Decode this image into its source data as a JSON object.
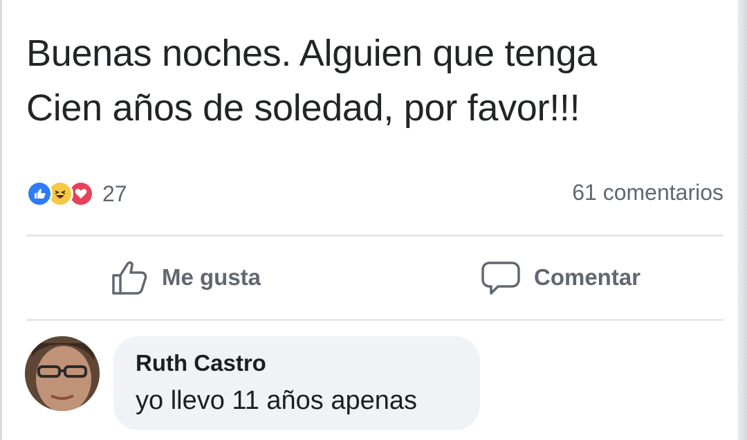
{
  "post": {
    "text_line1": "Buenas noches. Alguien que tenga",
    "text_line2": "Cien años de soledad, por favor!!!"
  },
  "reactions": {
    "types": [
      "like-icon",
      "haha-icon",
      "love-icon"
    ],
    "count": "27",
    "colors": {
      "like": "#2e7cf6",
      "haha": "#f7c843",
      "love": "#e8415a"
    }
  },
  "comments_summary": "61 comentarios",
  "actions": {
    "like_label": "Me gusta",
    "comment_label": "Comentar"
  },
  "comment": {
    "author": "Ruth Castro",
    "text": "yo llevo 11 años apenas"
  },
  "colors": {
    "text": "#1c1e21",
    "secondary_text": "#606770",
    "bubble": "#f0f2f5",
    "divider": "#e4e6ea"
  }
}
